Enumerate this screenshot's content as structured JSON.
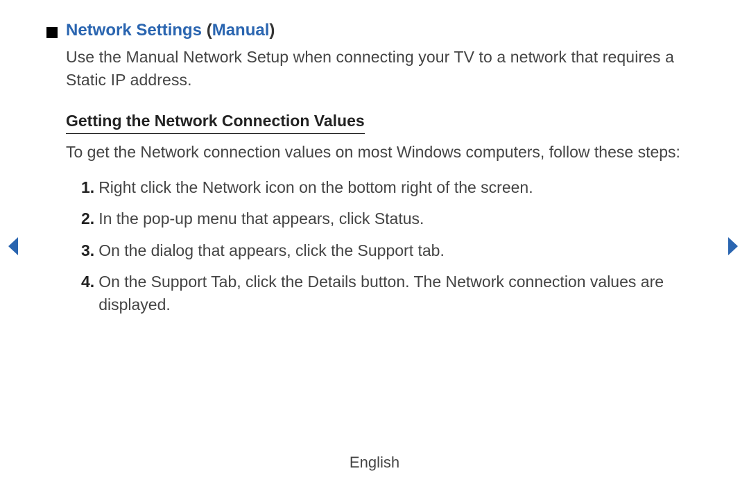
{
  "heading": {
    "title_main": "Network Settings",
    "title_paren_open": " (",
    "title_paren_inner": "Manual",
    "title_paren_close": ")"
  },
  "intro": "Use the Manual Network Setup when connecting your TV to a network that requires a Static IP address.",
  "subheading": "Getting the Network Connection Values",
  "sub_intro": "To get the Network connection values on most Windows computers, follow these steps:",
  "steps": [
    {
      "num": "1.",
      "text": "Right click the Network icon on the bottom right of the screen."
    },
    {
      "num": "2.",
      "text": "In the pop-up menu that appears, click Status."
    },
    {
      "num": "3.",
      "text": "On the dialog that appears, click the Support tab."
    },
    {
      "num": "4.",
      "text": "On the Support Tab, click the Details button. The Network connection values are displayed."
    }
  ],
  "footer": "English",
  "colors": {
    "accent_blue": "#2a65b0"
  }
}
